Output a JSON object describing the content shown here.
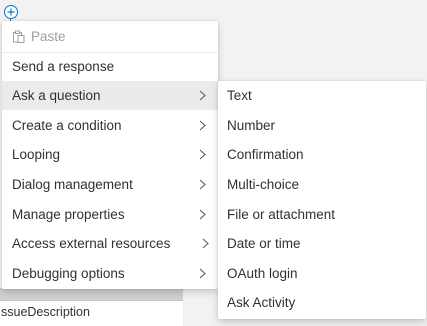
{
  "menu": {
    "paste_label": "Paste",
    "items": [
      {
        "label": "Send a response",
        "has_submenu": false
      },
      {
        "label": "Ask a question",
        "has_submenu": true,
        "selected": true
      },
      {
        "label": "Create a condition",
        "has_submenu": true
      },
      {
        "label": "Looping",
        "has_submenu": true
      },
      {
        "label": "Dialog management",
        "has_submenu": true
      },
      {
        "label": "Manage properties",
        "has_submenu": true
      },
      {
        "label": "Access external resources",
        "has_submenu": true
      },
      {
        "label": "Debugging options",
        "has_submenu": true
      }
    ]
  },
  "submenu": {
    "items": [
      {
        "label": "Text"
      },
      {
        "label": "Number"
      },
      {
        "label": "Confirmation"
      },
      {
        "label": "Multi-choice"
      },
      {
        "label": "File or attachment"
      },
      {
        "label": "Date or time"
      },
      {
        "label": "OAuth login"
      },
      {
        "label": "Ask Activity"
      }
    ]
  },
  "canvas": {
    "field_text": "ssueDescription"
  },
  "colors": {
    "accent": "#0078d4",
    "menu_bg": "#ffffff",
    "selected_bg": "#edebe9",
    "disabled_text": "#a19f9d",
    "text": "#323130"
  },
  "icons": {
    "add_node": "plus-circle-icon",
    "paste": "clipboard-icon",
    "submenu_indicator": "chevron-right-icon"
  }
}
